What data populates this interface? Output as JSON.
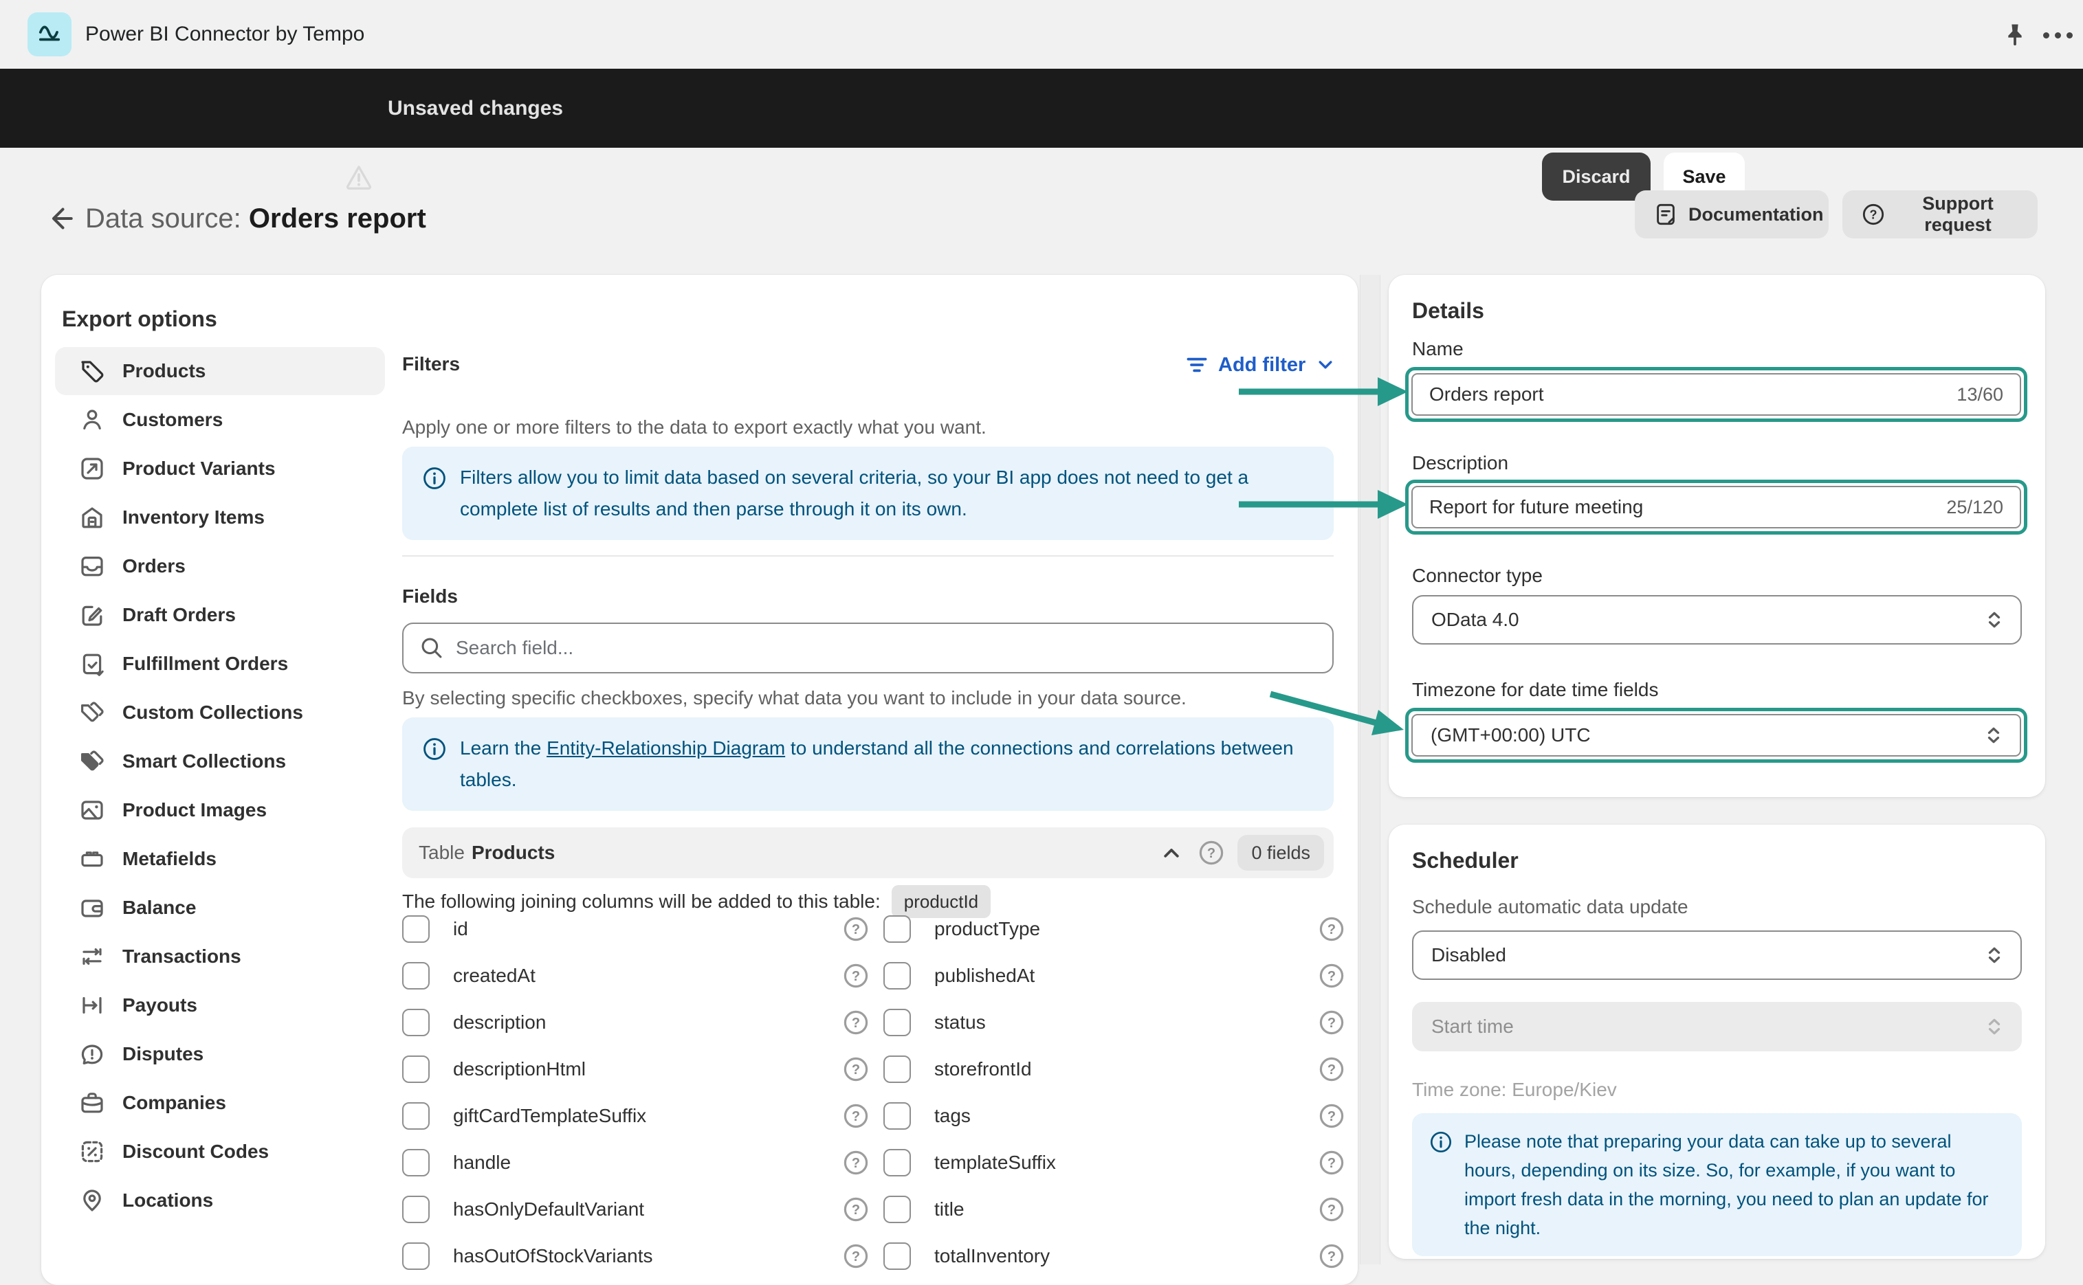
{
  "topbar": {
    "app_title": "Power BI Connector by Tempo"
  },
  "savebar": {
    "message": "Unsaved changes",
    "discard_label": "Discard",
    "save_label": "Save"
  },
  "page_header": {
    "title_prefix": "Data source:",
    "title_name": "Orders report",
    "documentation_label": "Documentation",
    "support_label": "Support request"
  },
  "export_options": {
    "heading": "Export options",
    "sidebar": {
      "items": [
        {
          "label": "Products",
          "icon": "tag",
          "active": true
        },
        {
          "label": "Customers",
          "icon": "person",
          "active": false
        },
        {
          "label": "Product Variants",
          "icon": "variant",
          "active": false
        },
        {
          "label": "Inventory Items",
          "icon": "inventory",
          "active": false
        },
        {
          "label": "Orders",
          "icon": "orders",
          "active": false
        },
        {
          "label": "Draft Orders",
          "icon": "draft",
          "active": false
        },
        {
          "label": "Fulfillment Orders",
          "icon": "fulfillment",
          "active": false
        },
        {
          "label": "Custom Collections",
          "icon": "custom-collections",
          "active": false
        },
        {
          "label": "Smart Collections",
          "icon": "smart-collections",
          "active": false
        },
        {
          "label": "Product Images",
          "icon": "image",
          "active": false
        },
        {
          "label": "Metafields",
          "icon": "metafields",
          "active": false
        },
        {
          "label": "Balance",
          "icon": "wallet",
          "active": false
        },
        {
          "label": "Transactions",
          "icon": "transactions",
          "active": false
        },
        {
          "label": "Payouts",
          "icon": "payouts",
          "active": false
        },
        {
          "label": "Disputes",
          "icon": "disputes",
          "active": false
        },
        {
          "label": "Companies",
          "icon": "briefcase",
          "active": false
        },
        {
          "label": "Discount Codes",
          "icon": "discount",
          "active": false
        },
        {
          "label": "Locations",
          "icon": "location",
          "active": false
        }
      ]
    },
    "filters": {
      "heading": "Filters",
      "add_filter_label": "Add filter",
      "description": "Apply one or more filters to the data to export exactly what you want.",
      "banner": "Filters allow you to limit data based on several criteria, so your BI app does not need to get a complete list of results and then parse through it on its own."
    },
    "fields": {
      "heading": "Fields",
      "search_placeholder": "Search field...",
      "description": "By selecting specific checkboxes, specify what data you want to include in your data source.",
      "banner_prefix": "Learn the ",
      "banner_link": "Entity-Relationship Diagram",
      "banner_suffix": " to understand all the connections and correlations between tables.",
      "table_label": "Table",
      "table_name": "Products",
      "fields_count": "0 fields",
      "joining_note": "The following joining columns will be added to this table:",
      "joining_chip": "productId",
      "columns": {
        "left": [
          "id",
          "createdAt",
          "description",
          "descriptionHtml",
          "giftCardTemplateSuffix",
          "handle",
          "hasOnlyDefaultVariant",
          "hasOutOfStockVariants"
        ],
        "right": [
          "productType",
          "publishedAt",
          "status",
          "storefrontId",
          "tags",
          "templateSuffix",
          "title",
          "totalInventory"
        ]
      }
    }
  },
  "details": {
    "heading": "Details",
    "name_label": "Name",
    "name_value": "Orders report",
    "name_counter": "13/60",
    "description_label": "Description",
    "description_value": "Report for future meeting",
    "description_counter": "25/120",
    "connector_label": "Connector type",
    "connector_value": "OData 4.0",
    "timezone_label": "Timezone for date time fields",
    "timezone_value": "(GMT+00:00) UTC"
  },
  "scheduler": {
    "heading": "Scheduler",
    "subtitle": "Schedule automatic data update",
    "mode_value": "Disabled",
    "start_time_placeholder": "Start time",
    "timezone_note": "Time zone: Europe/Kiev",
    "banner": "Please note that preparing your data can take up to several hours, depending on its size. So, for example, if you want to import fresh data in the morning, you need to plan an update for the night."
  },
  "colors": {
    "accent_teal": "#27998a",
    "link_blue": "#1f5dc9",
    "banner_bg": "#e8f3fb",
    "banner_text": "#00527c",
    "savebar_bg": "#1b1b1b"
  }
}
